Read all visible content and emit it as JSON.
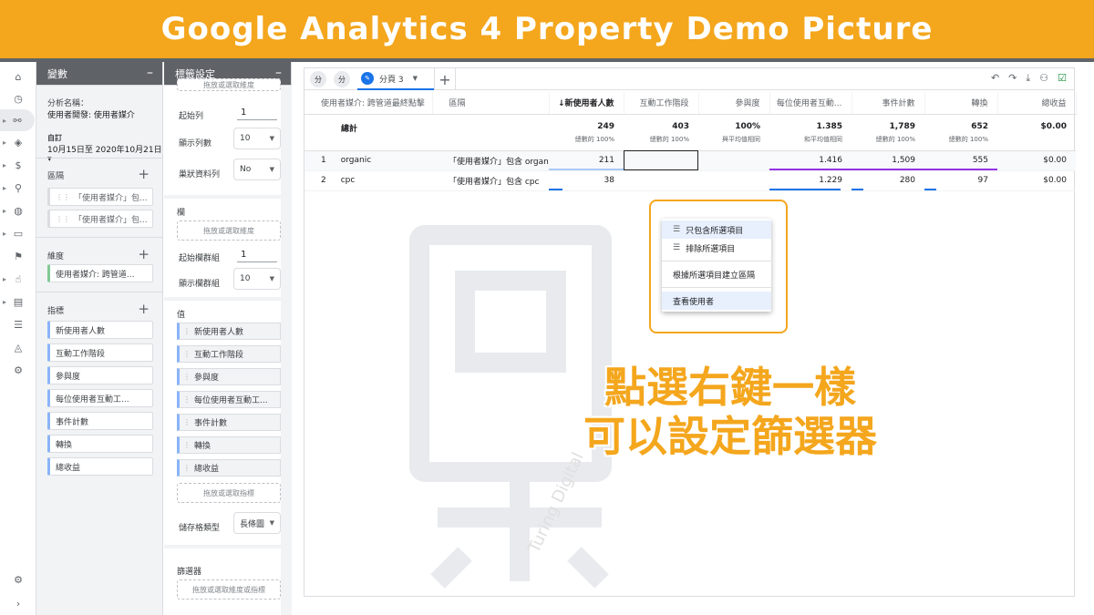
{
  "banner": {
    "title": "Google Analytics 4 Property Demo Picture"
  },
  "variables": {
    "header": "變數",
    "analysis_name_label": "分析名稱：",
    "analysis_name": "使用者開發: 使用者媒介",
    "date_preset": "自訂",
    "date_range": "10月15日至 2020年10月21日",
    "segments_title": "區隔",
    "segments": [
      "「使用者媒介」包...",
      "「使用者媒介」包..."
    ],
    "dimensions_title": "維度",
    "dimensions": [
      "使用者媒介: 跨管道..."
    ],
    "metrics_title": "指標",
    "metrics": [
      "新使用者人數",
      "互動工作階段",
      "參與度",
      "每位使用者互動工...",
      "事件計數",
      "轉換",
      "總收益"
    ]
  },
  "tab_settings": {
    "header": "標籤設定",
    "top_drop": "拖放或選取維度",
    "start_row_label": "起始列",
    "start_row_value": "1",
    "show_rows_label": "顯示列數",
    "show_rows_value": "10",
    "nested_rows_label": "巢狀資料列",
    "nested_rows_value": "No",
    "columns_title": "欄",
    "columns_drop": "拖放或選取維度",
    "start_col_label": "起始欄群組",
    "start_col_value": "1",
    "show_cols_label": "顯示欄群組",
    "show_cols_value": "10",
    "values_title": "值",
    "values": [
      "新使用者人數",
      "互動工作階段",
      "參與度",
      "每位使用者互動工...",
      "事件計數",
      "轉換",
      "總收益"
    ],
    "values_drop": "拖放或選取指標",
    "cell_type_label": "儲存格類型",
    "cell_type_value": "長條圖",
    "filters_title": "篩選器",
    "filters_drop": "拖放或選取維度或指標"
  },
  "canvas": {
    "tab_icon_1": "分",
    "tab_icon_2": "分",
    "active_tab": "分頁 3",
    "add_tab": "+",
    "columns": [
      "使用者媒介: 跨管道最終點擊",
      "區隔",
      "↓新使用者人數",
      "互動工作階段",
      "參與度",
      "每位使用者互動...",
      "事件計數",
      "轉換",
      "總收益"
    ],
    "totals": {
      "label": "總計",
      "new_users": "249",
      "new_users_sub": "總數的 100%",
      "sessions": "403",
      "sessions_sub": "總數的 100%",
      "engagement": "100%",
      "engagement_sub": "與平均值相同",
      "per_user": "1.385",
      "per_user_sub": "和平均值相同",
      "events": "1,789",
      "events_sub": "總數的 100%",
      "conversions": "652",
      "conversions_sub": "總數的 100%",
      "revenue": "$0.00"
    },
    "rows": [
      {
        "idx": "1",
        "medium": "organic",
        "segment": "「使用者媒介」包含 organic",
        "new_users": "211",
        "sessions": "",
        "engagement": "",
        "per_user": "1.416",
        "events": "1,509",
        "conversions": "555",
        "revenue": "$0.00"
      },
      {
        "idx": "2",
        "medium": "cpc",
        "segment": "「使用者媒介」包含 cpc",
        "new_users": "38",
        "sessions": "",
        "engagement": "",
        "per_user": "1.229",
        "events": "280",
        "conversions": "97",
        "revenue": "$0.00"
      }
    ]
  },
  "context_menu": {
    "include": "只包含所選項目",
    "exclude": "排除所選項目",
    "create_segment": "根據所選項目建立區隔",
    "view_users": "查看使用者"
  },
  "callout": {
    "line1": "點選右鍵一樣",
    "line2": "可以設定篩選器"
  },
  "watermark": {
    "text": "Turing Digital"
  },
  "colors": {
    "accent": "#f4a61d",
    "blue": "#1a73e8",
    "dimension": "#81c995",
    "metric": "#8ab4f8"
  }
}
